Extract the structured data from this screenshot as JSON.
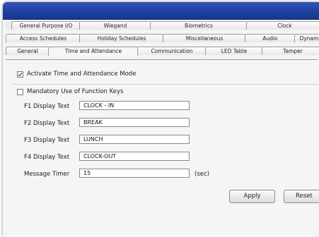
{
  "tabs": {
    "row1": [
      "General Purpose I/O",
      "Wiegand",
      "Biometrics",
      "Clock"
    ],
    "row2": [
      "Access Schedules",
      "Holiday Schedules",
      "Miscellaneous",
      "Audio",
      "Dynam"
    ],
    "row3": [
      "General",
      "Time and Attendance",
      "Communication",
      "LED Table",
      "Tamper"
    ]
  },
  "form": {
    "activate_label": "Activate Time and Attendance Mode",
    "activate_checked": true,
    "mandatory_label": "Mandatory Use of Function Keys",
    "mandatory_checked": false,
    "fields": [
      {
        "label": "F1 Display Text",
        "value": "CLOCK - IN"
      },
      {
        "label": "F2 Display Text",
        "value": "BREAK"
      },
      {
        "label": "F3 Display Text",
        "value": "LUNCH"
      },
      {
        "label": "F4 Display Text",
        "value": "CLOCK-OUT"
      },
      {
        "label": "Message Timer",
        "value": "15"
      }
    ],
    "timer_unit": "(sec)"
  },
  "buttons": {
    "apply": "Apply",
    "reset": "Reset"
  }
}
